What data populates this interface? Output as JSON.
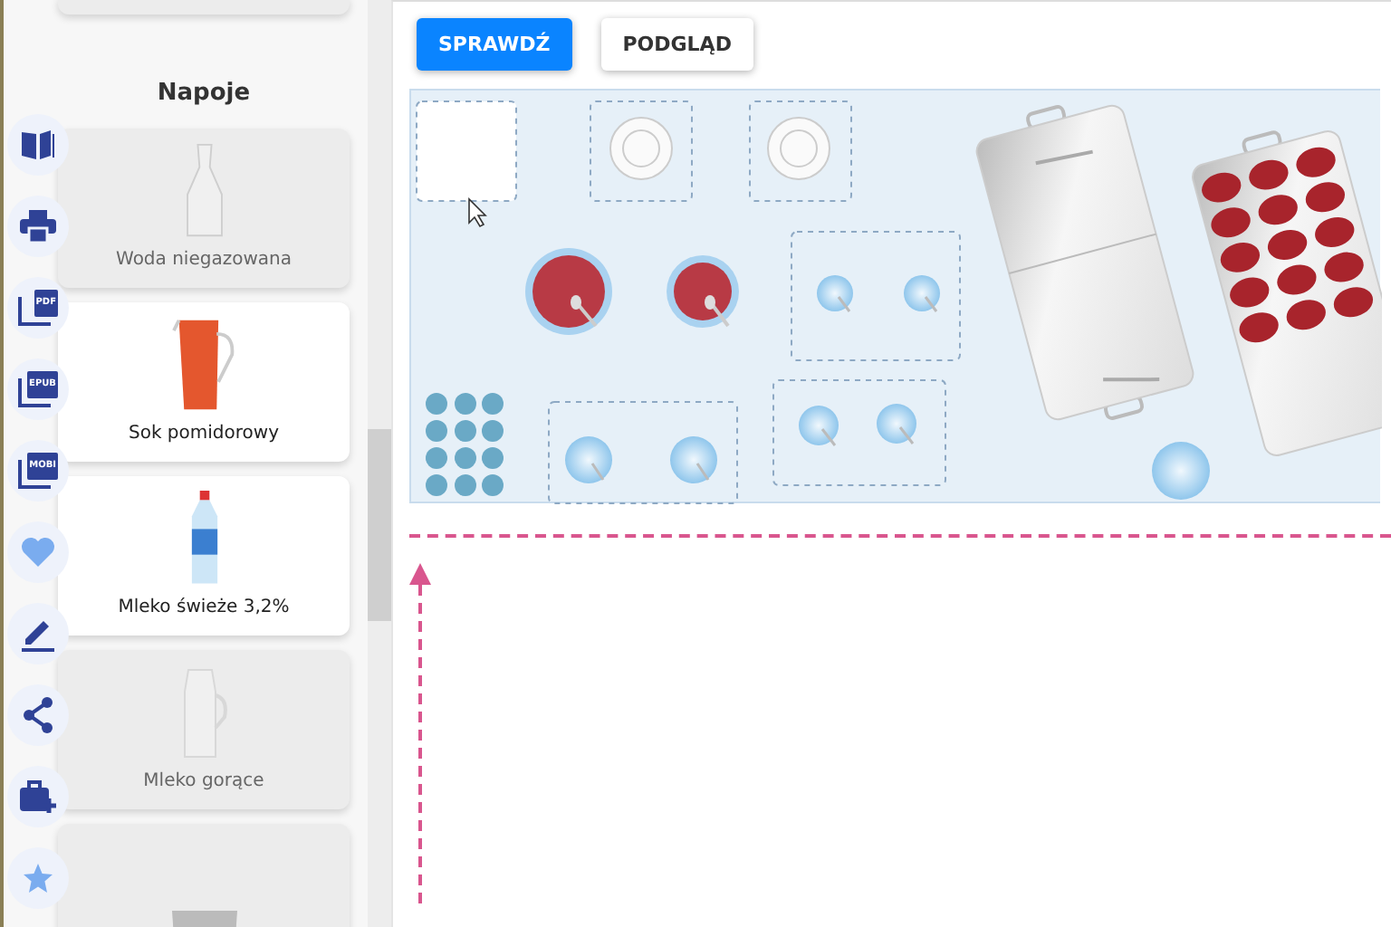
{
  "toolbar": [
    {
      "kind": "book"
    },
    {
      "kind": "print"
    },
    {
      "kind": "file",
      "label": "PDF"
    },
    {
      "kind": "file",
      "label": "EPUB"
    },
    {
      "kind": "file",
      "label": "MOBI"
    },
    {
      "kind": "heart"
    },
    {
      "kind": "pen"
    },
    {
      "kind": "share"
    },
    {
      "kind": "briefcase"
    },
    {
      "kind": "star"
    }
  ],
  "panel": {
    "section_title": "Napoje",
    "cards": [
      {
        "label": "Woda niegazowana",
        "kind": "carafe",
        "disabled": true
      },
      {
        "label": "Sok pomidorowy",
        "kind": "jug",
        "disabled": false
      },
      {
        "label": "Mleko świeże 3,2%",
        "kind": "bottle",
        "disabled": false
      },
      {
        "label": "Mleko gorące",
        "kind": "milk-jug",
        "disabled": true
      },
      {
        "kind": "cup",
        "disabled": true
      }
    ]
  },
  "buttons": [
    {
      "label": "SPRAWDŹ",
      "kind": "primary"
    },
    {
      "label": "PODGLĄD",
      "kind": "secondary"
    }
  ]
}
